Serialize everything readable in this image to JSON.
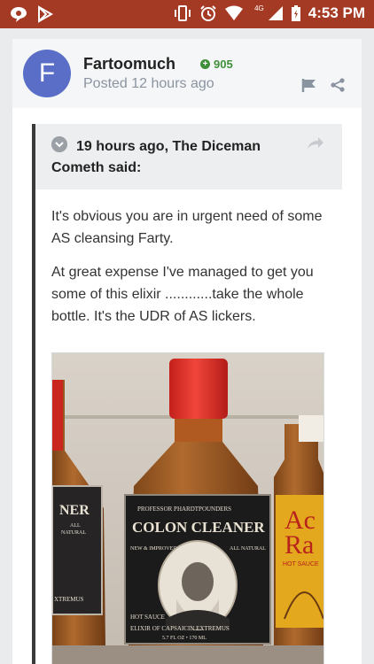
{
  "status_bar": {
    "time": "4:53 PM",
    "network": "4G",
    "icons": [
      "chat-notification-icon",
      "play-store-icon",
      "vibrate-icon",
      "alarm-icon",
      "wifi-icon",
      "signal-icon",
      "battery-icon"
    ]
  },
  "post": {
    "avatar_letter": "F",
    "author": "Fartoomuch",
    "reputation": "905",
    "posted": "Posted 12 hours ago",
    "colors": {
      "avatar": "#5a6ec8",
      "reputation": "#3f8f3a",
      "status_bar": "#a53a24"
    }
  },
  "quote": {
    "title": "19 hours ago, The Diceman Cometh said:",
    "paragraphs": [
      "It's obvious you are in urgent need of some AS cleansing Farty.",
      "At great expense I've managed to get you some of this elixir ............take the whole bottle. It's the UDR of AS lickers."
    ],
    "image": {
      "left_bottle_label": [
        "NER",
        "ALL",
        "NATURAL",
        "XTREMUS"
      ],
      "center_bottle": {
        "maker": "PROFESSOR PHARDTPOUNDERS",
        "product": "COLON CLEANER",
        "left_badge": "NEW & IMPROVED",
        "right_badge": "ALL NATURAL",
        "bottom_line1": "HOT SAUCE",
        "bottom_line2": "ELIXIR OF CAPSAICIN EXTREMUS",
        "bottom_line3": "5.7 FL OZ • 170 ML"
      },
      "right_bottle_label": [
        "Ac",
        "Ra",
        "HOT SAUCE"
      ]
    }
  }
}
